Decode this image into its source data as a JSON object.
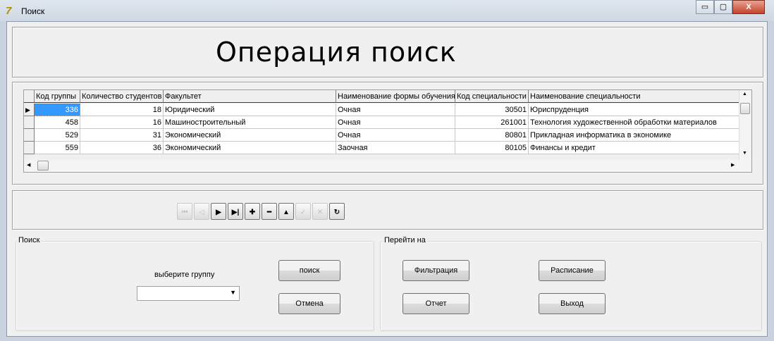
{
  "window": {
    "title": "Поиск",
    "minimize": "▭",
    "maximize": "▢",
    "close": "X"
  },
  "heading": "Операция поиск",
  "grid": {
    "columns": [
      "Код группы",
      "Количество студентов",
      "Факультет",
      "Наименование формы обучения",
      "Код специальности",
      "Наименование специальности"
    ],
    "rows": [
      [
        "336",
        "18",
        "Юридический",
        "Очная",
        "30501",
        "Юриспруденция"
      ],
      [
        "458",
        "16",
        "Машиностроительный",
        "Очная",
        "261001",
        "Технология художественной обработки материалов"
      ],
      [
        "529",
        "31",
        "Экономический",
        "Очная",
        "80801",
        "Прикладная информатика в экономике"
      ],
      [
        "559",
        "36",
        "Экономический",
        "Заочная",
        "80105",
        "Финансы и кредит"
      ]
    ],
    "current_row_marker": "▶"
  },
  "navigator": [
    {
      "name": "first",
      "glyph": "⏮",
      "enabled": false
    },
    {
      "name": "prior",
      "glyph": "◁",
      "enabled": false
    },
    {
      "name": "next",
      "glyph": "▶",
      "enabled": true
    },
    {
      "name": "last",
      "glyph": "▶|",
      "enabled": true
    },
    {
      "name": "insert",
      "glyph": "✚",
      "enabled": true
    },
    {
      "name": "delete",
      "glyph": "━",
      "enabled": true
    },
    {
      "name": "edit",
      "glyph": "▲",
      "enabled": true
    },
    {
      "name": "post",
      "glyph": "✓",
      "enabled": false
    },
    {
      "name": "cancel",
      "glyph": "✕",
      "enabled": false
    },
    {
      "name": "refresh",
      "glyph": "↻",
      "enabled": true
    }
  ],
  "search": {
    "group_label": "Поиск",
    "prompt": "выберите группу",
    "combo_value": "",
    "search_button": "поиск",
    "cancel_button": "Отмена"
  },
  "goto": {
    "group_label": "Перейти на",
    "filter": "Фильтрация",
    "schedule": "Расписание",
    "report": "Отчет",
    "exit": "Выход"
  }
}
